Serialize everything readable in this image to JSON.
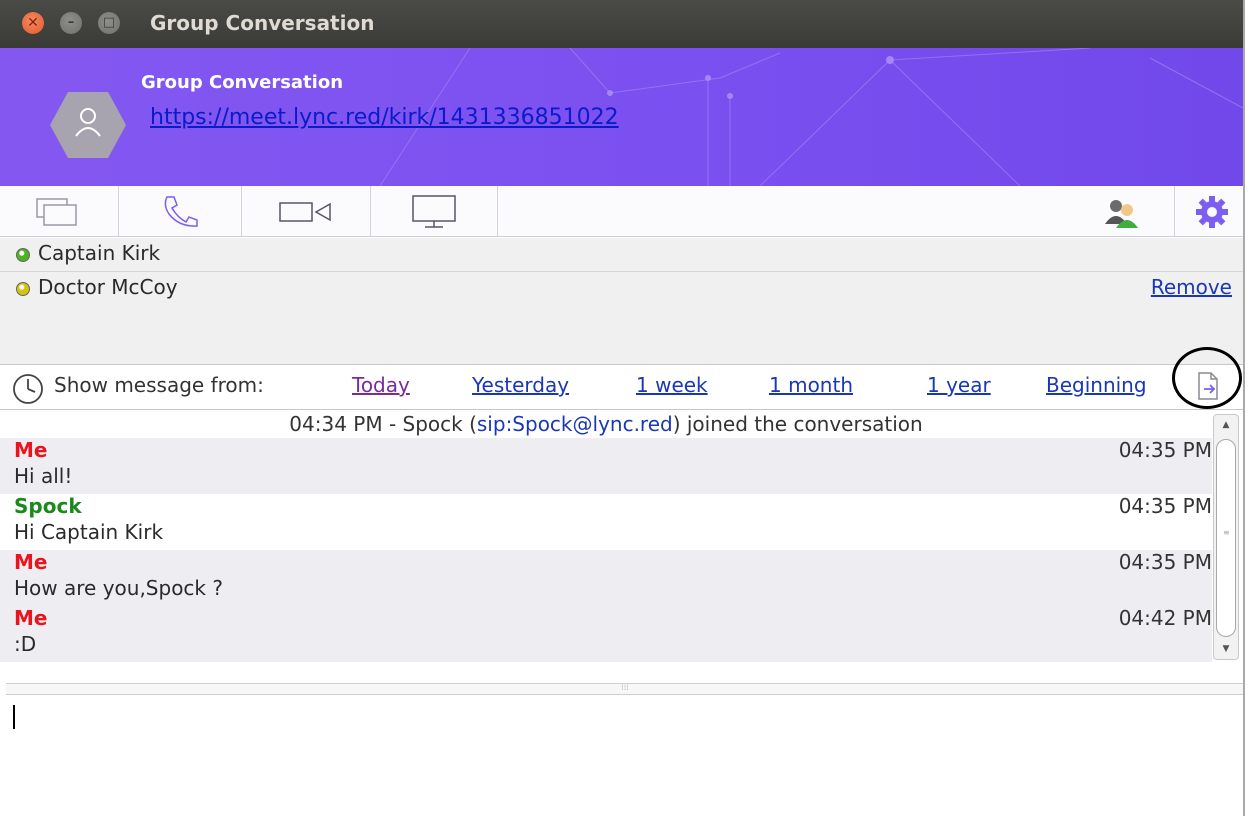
{
  "window": {
    "title": "Group Conversation"
  },
  "header": {
    "group_name": "Group Conversation",
    "link": "https://meet.lync.red/kirk/1431336851022"
  },
  "toolbar": {
    "buttons": [
      {
        "icon": "chat-icon"
      },
      {
        "icon": "phone-icon"
      },
      {
        "icon": "video-icon"
      },
      {
        "icon": "screen-share-icon"
      },
      {
        "icon": "add-contacts-icon"
      },
      {
        "icon": "gear-icon"
      }
    ]
  },
  "participants": [
    {
      "name": "Captain Kirk",
      "status_color": "#4bb51f"
    },
    {
      "name": "Doctor McCoy",
      "status_color": "#d4c40e"
    }
  ],
  "participant_action": "Remove",
  "history_filter": {
    "label": "Show message from:",
    "options": [
      "Today",
      "Yesterday",
      "1 week",
      "1 month",
      "1 year",
      "Beginning"
    ],
    "selected": "Today"
  },
  "messages": {
    "join": {
      "time": "04:34 PM - Spock (",
      "sip": "sip:Spock@lync.red",
      "suffix": ") joined the conversation"
    },
    "items": [
      {
        "sender": "Me",
        "sender_color": "#e8141e",
        "time": "04:35 PM",
        "text": "Hi all!"
      },
      {
        "sender": "Spock",
        "sender_color": "#1a8a1a",
        "time": "04:35 PM",
        "text": "Hi Captain Kirk"
      },
      {
        "sender": "Me",
        "sender_color": "#e8141e",
        "time": "04:35 PM",
        "text": "How are you,Spock ?"
      },
      {
        "sender": "Me",
        "sender_color": "#e8141e",
        "time": "04:42 PM",
        "text": ":D"
      }
    ]
  },
  "colors": {
    "accent": "#7a4ff0",
    "link": "#1a37b8",
    "visited_link": "#7a2a9a"
  }
}
